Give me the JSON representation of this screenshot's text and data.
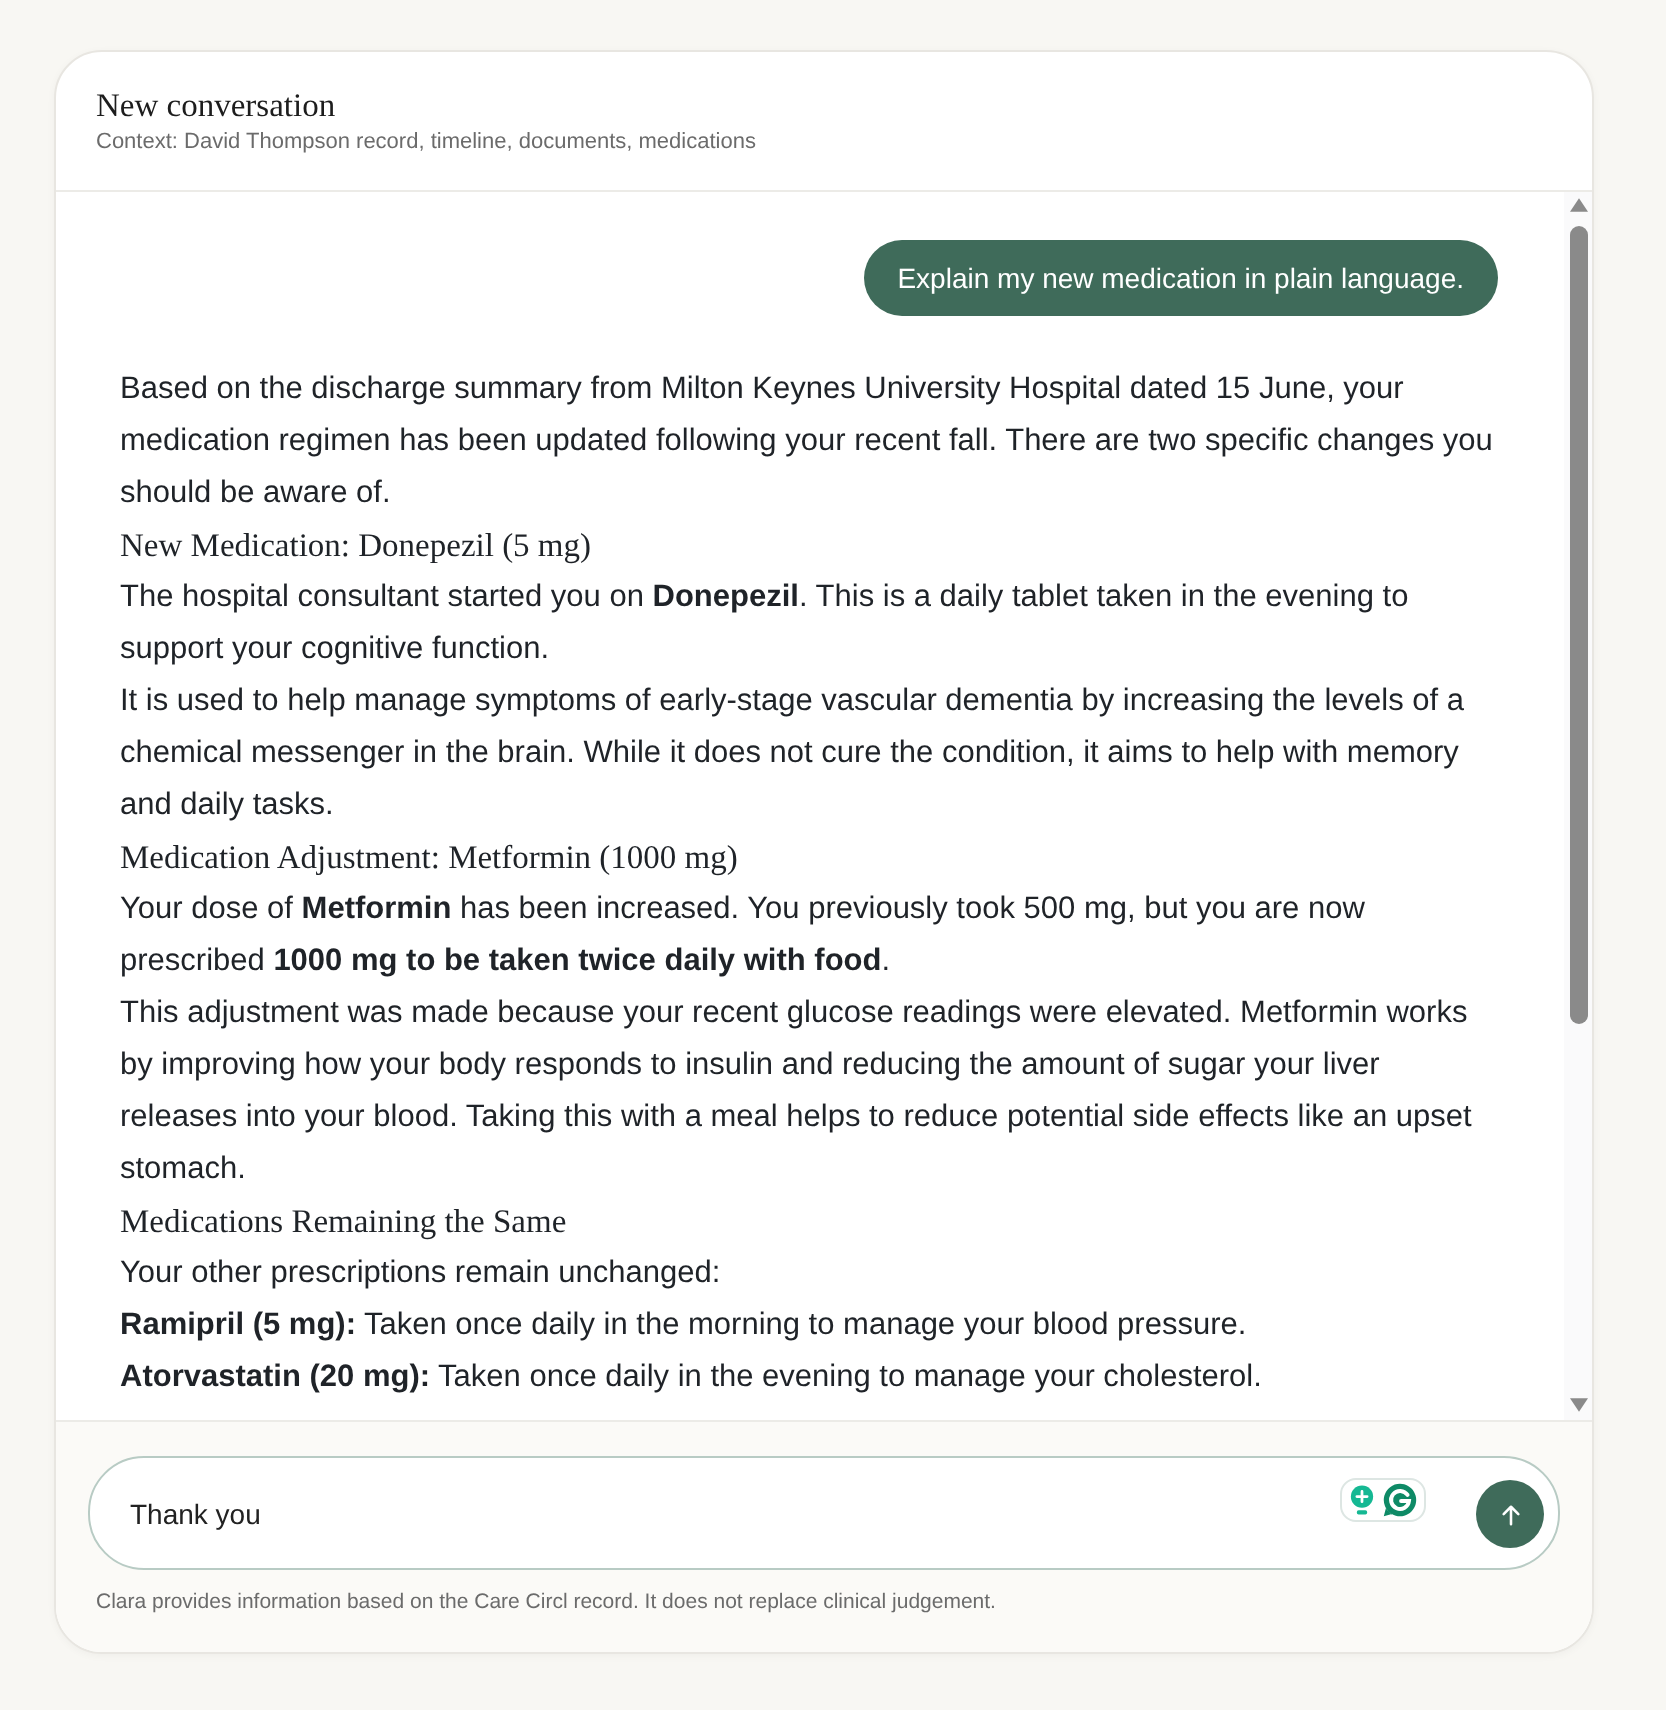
{
  "header": {
    "title": "New conversation",
    "context": "Context: David Thompson record, timeline, documents, medications"
  },
  "messages": [
    {
      "kind": "bubble",
      "text": "Explain my new medication in plain language."
    },
    {
      "kind": "reply",
      "blocks": [
        {
          "kind": "paragraph",
          "text": "Based on the discharge summary from Milton Keynes University Hospital dated 15 June, your medication regimen has been updated following your recent fall. There are two specific changes you should be aware of."
        },
        {
          "kind": "heading",
          "text": "New Medication: Donepezil (5 mg)"
        },
        {
          "kind": "paragraph",
          "text": "The hospital consultant started you on **Donepezil**. This is a daily tablet taken in the evening to support your cognitive function."
        },
        {
          "kind": "paragraph",
          "text": "It is used to help manage symptoms of early-stage vascular dementia by increasing the levels of a chemical messenger in the brain. While it does not cure the condition, it aims to help with memory and daily tasks."
        },
        {
          "kind": "heading",
          "text": "Medication Adjustment: Metformin (1000 mg)"
        },
        {
          "kind": "paragraph",
          "text": "Your dose of **Metformin** has been increased. You previously took 500 mg, but you are now prescribed **1000 mg to be taken twice daily with food**."
        },
        {
          "kind": "paragraph",
          "text": "This adjustment was made because your recent glucose readings were elevated. Metformin works by improving how your body responds to insulin and reducing the amount of sugar your liver releases into your blood. Taking this with a meal helps to reduce potential side effects like an upset stomach."
        },
        {
          "kind": "heading",
          "text": "Medications Remaining the Same"
        },
        {
          "kind": "paragraph",
          "text": "Your other prescriptions remain unchanged:"
        },
        {
          "kind": "paragraph",
          "text": "**Ramipril (5 mg):** Taken once daily in the morning to manage your blood pressure."
        },
        {
          "kind": "paragraph",
          "text": "**Atorvastatin (20 mg):** Taken once daily in the evening to manage your cholesterol."
        }
      ]
    }
  ],
  "composer": {
    "value": "Thank you"
  },
  "disclaimer": "Clara provides information based on the Care Circl record. It does not replace clinical judgement."
}
